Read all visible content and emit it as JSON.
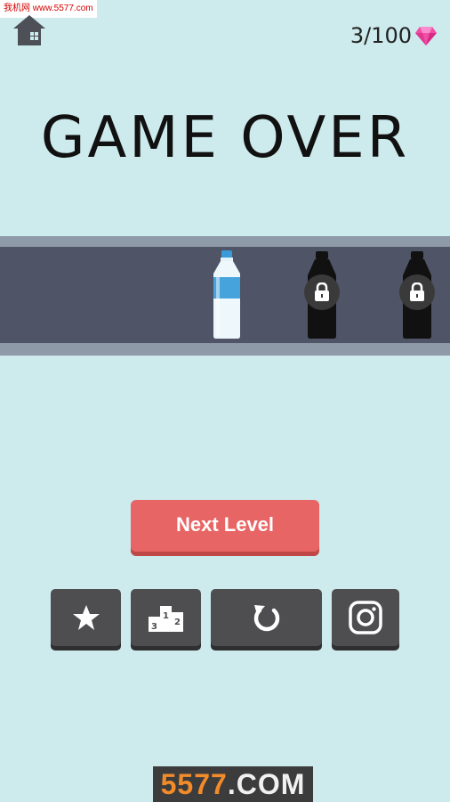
{
  "watermark_top": "我机网 www.5577.com",
  "gems": {
    "count": "3/100",
    "icon": "pink-diamond-icon",
    "color": "#f24ea6"
  },
  "title": "GAME OVER",
  "bottles": [
    {
      "name": "water-bottle",
      "state": "selected"
    },
    {
      "name": "black-bottle",
      "state": "locked"
    },
    {
      "name": "black-bottle",
      "state": "locked"
    }
  ],
  "buttons": {
    "next_level": "Next Level",
    "podium_numbers": [
      "3",
      "1",
      "2"
    ]
  },
  "icons": {
    "home": "home-icon",
    "star": "star-icon",
    "leaderboard": "podium-icon",
    "restart": "restart-icon",
    "instagram": "instagram-icon",
    "lock": "lock-icon"
  },
  "colors": {
    "background": "#cdeaec",
    "next_button": "#e86565",
    "icon_button": "#4e4e50",
    "shelf": "#4f5567"
  },
  "watermark_bottom": {
    "num": "5577",
    "rest": ".COM"
  }
}
